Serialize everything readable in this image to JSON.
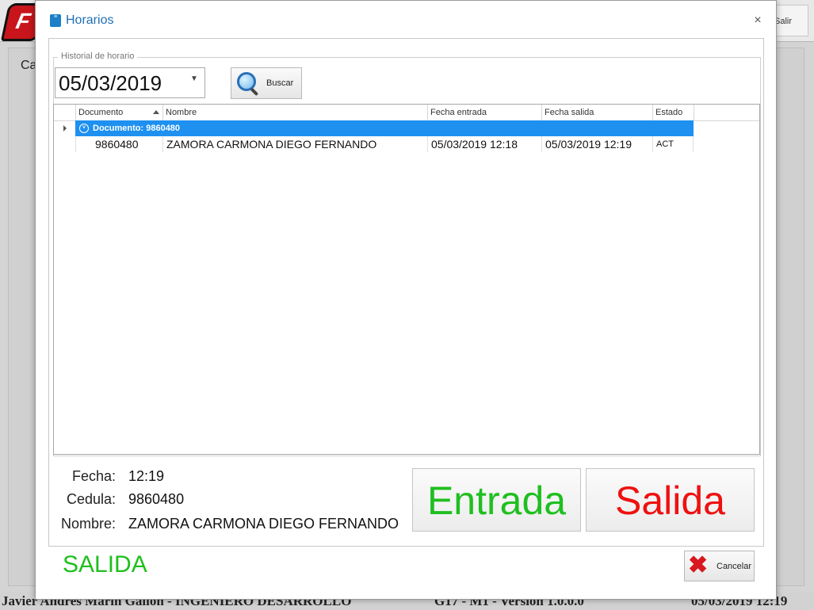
{
  "background": {
    "logo_text": "F",
    "exit_label": "Salir",
    "content_label": "Ca",
    "status_user": "Javier Andres Marin Gallon - INGENIERO DESARROLLO",
    "status_version": "G17 - M1 - Version 1.0.0.0",
    "status_datetime": "05/03/2019 12:19"
  },
  "dialog": {
    "title": "Horarios",
    "icon_name": "app-icon",
    "close_glyph": "×",
    "group_legend": "Historial de horario",
    "date_value": "05/03/2019",
    "search_label": "Buscar",
    "grid": {
      "columns": [
        "Documento",
        "Nombre",
        "Fecha entrada",
        "Fecha salida",
        "Estado"
      ],
      "group_label": "Documento: 9860480",
      "rows": [
        {
          "documento": "9860480",
          "nombre": "ZAMORA CARMONA DIEGO FERNANDO",
          "fecha_entrada": "05/03/2019 12:18",
          "fecha_salida": "05/03/2019 12:19",
          "estado": "ACT"
        }
      ]
    },
    "info": {
      "fecha_label": "Fecha:",
      "fecha_value": "12:19",
      "cedula_label": "Cedula:",
      "cedula_value": "9860480",
      "nombre_label": "Nombre:",
      "nombre_value": "ZAMORA CARMONA DIEGO FERNANDO"
    },
    "entrada_label": "Entrada",
    "salida_label": "Salida",
    "status_text": "SALIDA",
    "cancel_label": "Cancelar",
    "colors": {
      "entrada": "#1fbf1f",
      "salida": "#ee1111",
      "group_row": "#1e90f0",
      "title": "#1f6fb5"
    }
  }
}
